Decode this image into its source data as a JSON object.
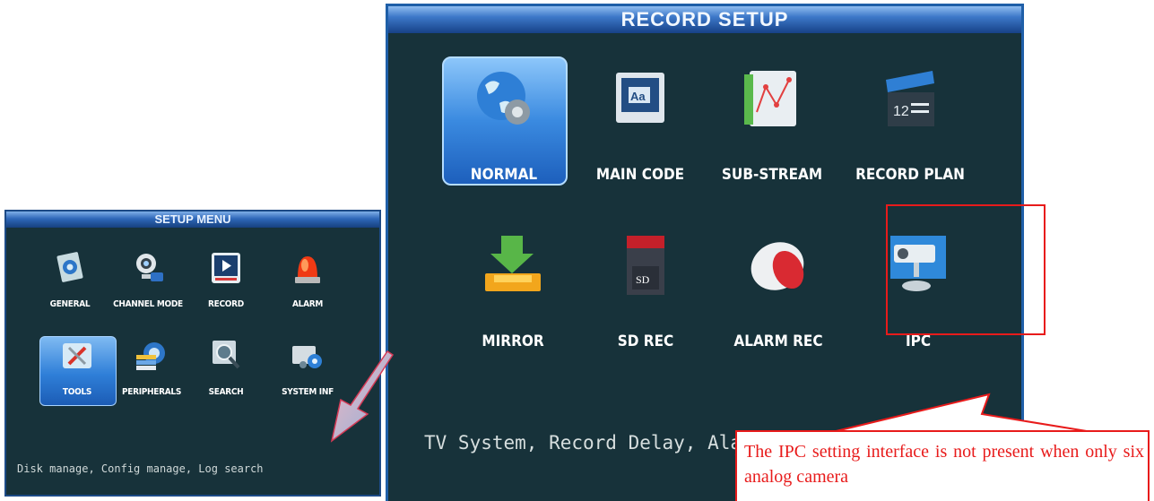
{
  "setup_menu": {
    "title": "SETUP  MENU",
    "items": [
      {
        "label": "GENERAL",
        "icon": "gear-globe-icon"
      },
      {
        "label": "CHANNEL MODE",
        "icon": "webcam-icon"
      },
      {
        "label": "RECORD",
        "icon": "record-play-icon"
      },
      {
        "label": "ALARM",
        "icon": "alarm-siren-icon"
      },
      {
        "label": "TOOLS",
        "icon": "tools-icon",
        "selected": true
      },
      {
        "label": "PERIPHERALS",
        "icon": "peripherals-icon"
      },
      {
        "label": "SEARCH",
        "icon": "search-icon"
      },
      {
        "label": "SYSTEM INF",
        "icon": "system-info-icon"
      }
    ],
    "description": "Disk manage, Config manage, Log search"
  },
  "record_setup": {
    "title": "RECORD  SETUP",
    "items": [
      {
        "label": "NORMAL",
        "icon": "globe-gear-icon",
        "selected": true
      },
      {
        "label": "MAIN CODE",
        "icon": "text-font-icon"
      },
      {
        "label": "SUB-STREAM",
        "icon": "line-chart-icon"
      },
      {
        "label": "RECORD PLAN",
        "icon": "clapperboard-icon"
      },
      {
        "label": "MIRROR",
        "icon": "download-tray-icon"
      },
      {
        "label": "SD REC",
        "icon": "sd-card-icon",
        "sd_text": "SD"
      },
      {
        "label": "ALARM REC",
        "icon": "alarm-speaker-icon"
      },
      {
        "label": "IPC",
        "icon": "ip-camera-icon"
      }
    ],
    "description": "TV System, Record Delay, Alarm Delay"
  },
  "annotation": {
    "callout_text": "The IPC setting interface is not present when only six analog camera",
    "color": "#e81b1b"
  },
  "colors": {
    "panel_bg": "#17323a",
    "title_blue": "#3c77c8",
    "selected_blue": "#3a8ae0"
  }
}
